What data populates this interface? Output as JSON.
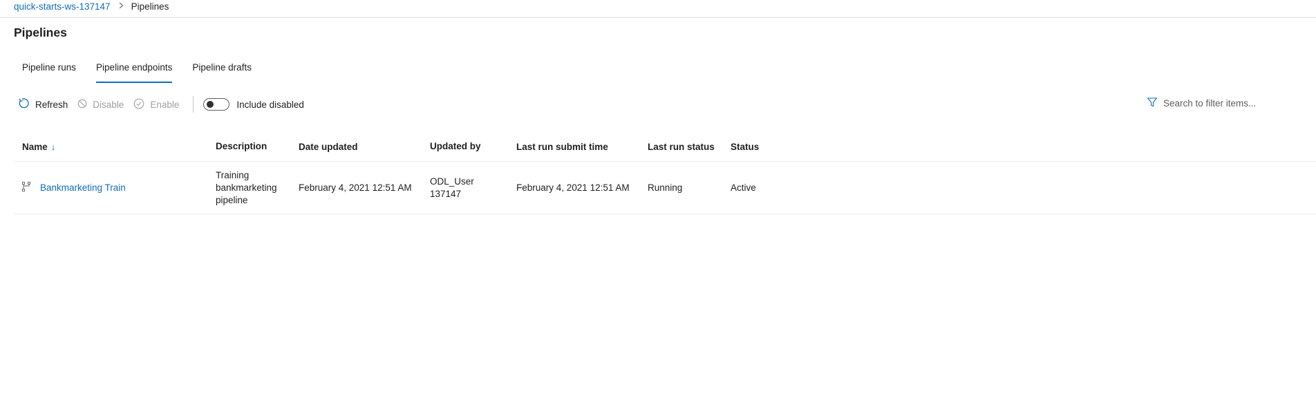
{
  "breadcrumb": {
    "workspace": "quick-starts-ws-137147",
    "separator": ">",
    "current": "Pipelines"
  },
  "page": {
    "title": "Pipelines"
  },
  "tabs": [
    {
      "label": "Pipeline runs",
      "active": false
    },
    {
      "label": "Pipeline endpoints",
      "active": true
    },
    {
      "label": "Pipeline drafts",
      "active": false
    }
  ],
  "toolbar": {
    "refresh": "Refresh",
    "disable": "Disable",
    "enable": "Enable",
    "include_disabled": "Include disabled",
    "include_disabled_on": false
  },
  "search": {
    "placeholder": "Search to filter items..."
  },
  "table": {
    "columns": {
      "name": "Name",
      "name_sort": "↓",
      "description": "Description",
      "date_updated": "Date updated",
      "updated_by": "Updated by",
      "last_run_submit_time": "Last run submit time",
      "last_run_status": "Last run status",
      "status": "Status"
    },
    "rows": [
      {
        "name": "Bankmarketing Train",
        "description": "Training bankmarketing pipeline",
        "date_updated": "February 4, 2021 12:51 AM",
        "updated_by": "ODL_User 137147",
        "last_run_submit_time": "February 4, 2021 12:51 AM",
        "last_run_status": "Running",
        "status": "Active",
        "icon": "pipeline-icon"
      }
    ]
  },
  "colors": {
    "accent": "#0f6cbd",
    "text": "#201f1e",
    "disabled": "#a19f9d",
    "divider": "#edebe9"
  }
}
